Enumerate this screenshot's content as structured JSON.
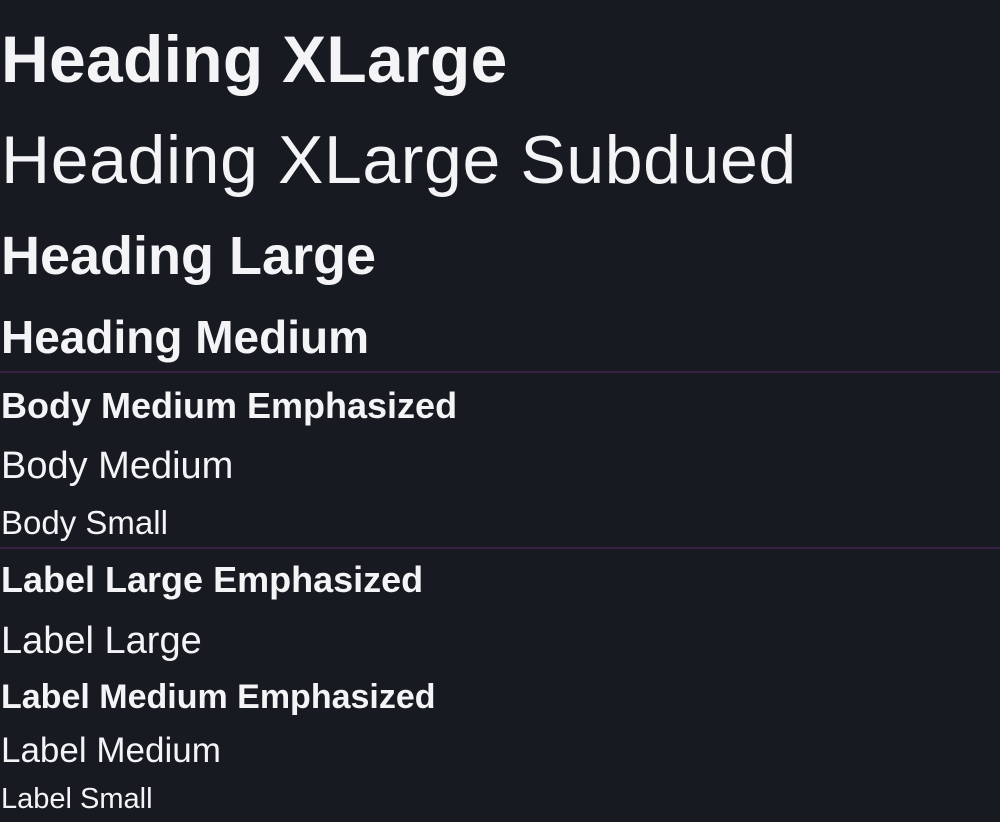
{
  "typography": {
    "heading_xlarge": "Heading XLarge",
    "heading_xlarge_subdued": "Heading XLarge Subdued",
    "heading_large": "Heading Large",
    "heading_medium": "Heading Medium",
    "body_medium_emphasized": "Body Medium Emphasized",
    "body_medium": "Body Medium",
    "body_small": "Body Small",
    "label_large_emphasized": "Label Large Emphasized",
    "label_large": "Label Large",
    "label_medium_emphasized": "Label Medium Emphasized",
    "label_medium": "Label Medium",
    "label_small": "Label Small"
  },
  "colors": {
    "background": "#171a21",
    "text": "#f4f4f6",
    "divider": "#3a1f45"
  }
}
